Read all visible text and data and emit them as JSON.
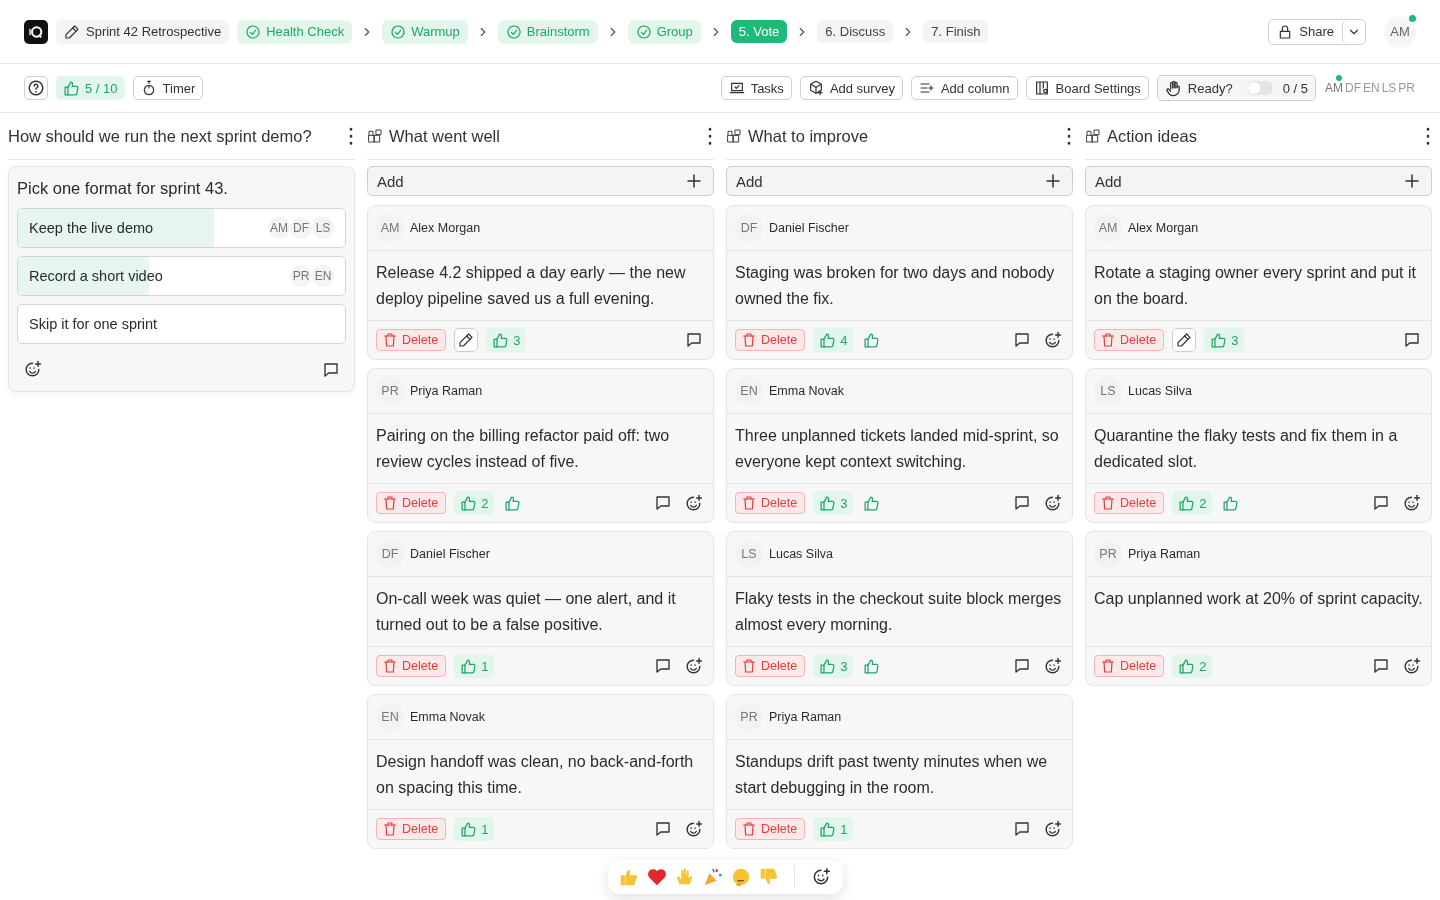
{
  "board_title": "Sprint 42 Retrospective",
  "steps": [
    {
      "label": "Health Check",
      "done": true,
      "selected": false
    },
    {
      "label": "Warmup",
      "done": true,
      "selected": false
    },
    {
      "label": "Brainstorm",
      "done": true,
      "selected": false
    },
    {
      "label": "Group",
      "done": true,
      "selected": false
    },
    {
      "label": "5. Vote",
      "done": false,
      "selected": true
    },
    {
      "label": "6. Discuss",
      "done": false,
      "selected": false
    },
    {
      "label": "7. Finish",
      "done": false,
      "selected": false
    }
  ],
  "share": {
    "label": "Share"
  },
  "user": {
    "initials": "AM",
    "online": true
  },
  "toolbar": {
    "votes": "5 / 10",
    "timer": "Timer",
    "actions": [
      "Tasks",
      "Add survey",
      "Add column",
      "Board Settings"
    ],
    "ready": {
      "label": "Ready?",
      "on": false,
      "count": "0 / 5"
    },
    "participants": [
      {
        "initials": "AM",
        "online": true
      },
      {
        "initials": "DF",
        "online": false
      },
      {
        "initials": "EN",
        "online": false
      },
      {
        "initials": "LS",
        "online": false
      },
      {
        "initials": "PR",
        "online": false
      }
    ]
  },
  "poll": {
    "question": "How should we run the next sprint demo?",
    "prompt": "Pick one format for sprint 43.",
    "options": [
      {
        "label": "Keep the live demo",
        "level": 0.6,
        "voters": [
          "AM",
          "DF",
          "LS"
        ]
      },
      {
        "label": "Record a short video",
        "level": 0.4,
        "voters": [
          "PR",
          "EN"
        ]
      },
      {
        "label": "Skip it for one sprint",
        "level": 0
      }
    ]
  },
  "columns": [
    {
      "title": "What went well",
      "add_label": "Add",
      "cards": [
        {
          "initials": "AM",
          "author": "Alex Morgan",
          "text": "Release 4.2 shipped a day early — the new deploy pipeline saved us a full evening.",
          "delete_label": "Delete",
          "editable": true,
          "votes": "3",
          "can_vote": false,
          "can_react": false
        },
        {
          "initials": "PR",
          "author": "Priya Raman",
          "text": "Pairing on the billing refactor paid off: two review cycles instead of five.",
          "delete_label": "Delete",
          "editable": false,
          "votes": "2",
          "can_vote": true,
          "can_react": true
        },
        {
          "initials": "DF",
          "author": "Daniel Fischer",
          "text": "On-call week was quiet — one alert, and it turned out to be a false positive.",
          "delete_label": "Delete",
          "editable": false,
          "votes": "1",
          "can_vote": false,
          "can_react": true
        },
        {
          "initials": "EN",
          "author": "Emma Novak",
          "text": "Design handoff was clean, no back-and-forth on spacing this time.",
          "delete_label": "Delete",
          "editable": false,
          "votes": "1",
          "can_vote": false,
          "can_react": true
        }
      ]
    },
    {
      "title": "What to improve",
      "add_label": "Add",
      "cards": [
        {
          "initials": "DF",
          "author": "Daniel Fischer",
          "text": "Staging was broken for two days and nobody owned the fix.",
          "delete_label": "Delete",
          "editable": false,
          "votes": "4",
          "can_vote": true,
          "can_react": true
        },
        {
          "initials": "EN",
          "author": "Emma Novak",
          "text": "Three unplanned tickets landed mid-sprint, so everyone kept context switching.",
          "delete_label": "Delete",
          "editable": false,
          "votes": "3",
          "can_vote": true,
          "can_react": true
        },
        {
          "initials": "LS",
          "author": "Lucas Silva",
          "text": "Flaky tests in the checkout suite block merges almost every morning.",
          "delete_label": "Delete",
          "editable": false,
          "votes": "3",
          "can_vote": true,
          "can_react": true
        },
        {
          "initials": "PR",
          "author": "Priya Raman",
          "text": "Standups drift past twenty minutes when we start debugging in the room.",
          "delete_label": "Delete",
          "editable": false,
          "votes": "1",
          "can_vote": false,
          "can_react": true
        }
      ]
    },
    {
      "title": "Action ideas",
      "add_label": "Add",
      "cards": [
        {
          "initials": "AM",
          "author": "Alex Morgan",
          "text": "Rotate a staging owner every sprint and put it on the board.",
          "delete_label": "Delete",
          "editable": true,
          "votes": "3",
          "can_vote": false,
          "can_react": false
        },
        {
          "initials": "LS",
          "author": "Lucas Silva",
          "text": "Quarantine the flaky tests and fix them in a dedicated slot.",
          "delete_label": "Delete",
          "editable": false,
          "votes": "2",
          "can_vote": true,
          "can_react": true
        },
        {
          "initials": "PR",
          "author": "Priya Raman",
          "text": "Cap unplanned work at 20% of sprint capacity.",
          "delete_label": "Delete",
          "editable": false,
          "votes": "2",
          "can_vote": false,
          "can_react": true
        }
      ]
    }
  ]
}
